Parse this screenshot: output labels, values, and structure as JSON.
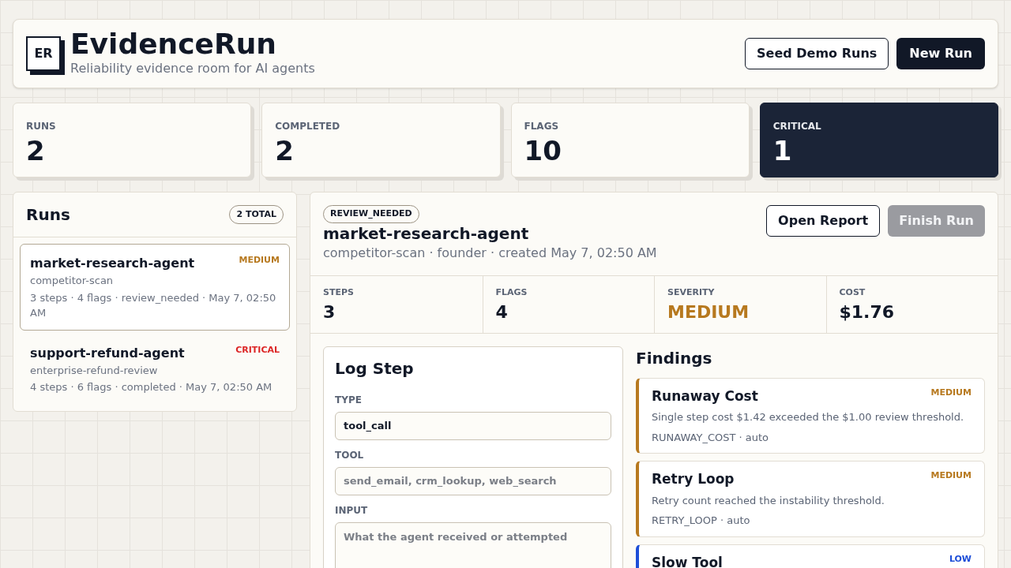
{
  "header": {
    "logo": "ER",
    "title": "EvidenceRun",
    "subtitle": "Reliability evidence room for AI agents",
    "buttons": [
      {
        "label": "Seed Demo Runs",
        "kind": "outline"
      },
      {
        "label": "New Run",
        "kind": "solid"
      }
    ]
  },
  "stats": [
    {
      "label": "RUNS",
      "value": "2",
      "kind": "plain"
    },
    {
      "label": "COMPLETED",
      "value": "2",
      "kind": "plain"
    },
    {
      "label": "FLAGS",
      "value": "10",
      "kind": "plain"
    },
    {
      "label": "CRITICAL",
      "value": "1",
      "kind": "dark"
    }
  ],
  "runs": {
    "title": "Runs",
    "count": "2 TOTAL",
    "items": [
      {
        "name": "market-research-agent",
        "severity": "MEDIUM",
        "color": "#b7791f",
        "task": "competitor-scan",
        "meta": "3 steps · 4 flags · review_needed · May 7, 02:50 AM",
        "selected": true
      },
      {
        "name": "support-refund-agent",
        "severity": "CRITICAL",
        "color": "#dc2626",
        "task": "enterprise-refund-review",
        "meta": "4 steps · 6 flags · completed · May 7, 02:50 AM",
        "selected": false
      }
    ]
  },
  "detail": {
    "status": "REVIEW_NEEDED",
    "title": "market-research-agent",
    "meta": "competitor-scan · founder · created May 7, 02:50 AM",
    "buttons": [
      {
        "label": "Open Report",
        "disabled": false
      },
      {
        "label": "Finish Run",
        "disabled": true
      }
    ],
    "metrics": [
      {
        "label": "STEPS",
        "value": "3"
      },
      {
        "label": "FLAGS",
        "value": "4"
      },
      {
        "label": "SEVERITY",
        "value": "MEDIUM",
        "color": "#b7791f"
      },
      {
        "label": "COST",
        "value": "$1.76"
      }
    ]
  },
  "log_step": {
    "title": "Log Step",
    "fields": [
      {
        "label": "TYPE",
        "value": "tool_call",
        "kind": "input"
      },
      {
        "label": "TOOL",
        "placeholder": "send_email, crm_lookup, web_search",
        "kind": "input"
      },
      {
        "label": "INPUT",
        "placeholder": "What the agent received or attempted",
        "kind": "textarea"
      }
    ]
  },
  "findings": {
    "title": "Findings",
    "items": [
      {
        "title": "Runaway Cost",
        "severity": "MEDIUM",
        "color": "#b7791f",
        "description": "Single step cost $1.42 exceeded the $1.00 review threshold.",
        "code": "RUNAWAY_COST · auto"
      },
      {
        "title": "Retry Loop",
        "severity": "MEDIUM",
        "color": "#b7791f",
        "description": "Retry count reached the instability threshold.",
        "code": "RETRY_LOOP · auto"
      },
      {
        "title": "Slow Tool",
        "severity": "LOW",
        "color": "#1d4ed8"
      }
    ]
  }
}
